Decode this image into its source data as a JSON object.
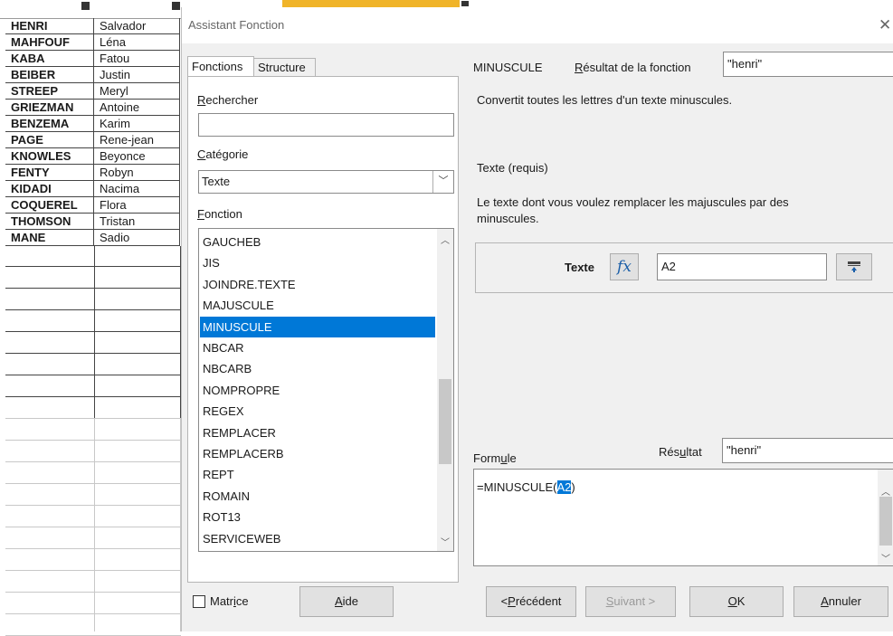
{
  "sheet": {
    "rows": [
      {
        "a": "HENRI",
        "b": "Salvador"
      },
      {
        "a": "MAHFOUF",
        "b": "Léna"
      },
      {
        "a": "KABA",
        "b": "Fatou"
      },
      {
        "a": "BEIBER",
        "b": "Justin"
      },
      {
        "a": "STREEP",
        "b": "Meryl"
      },
      {
        "a": "GRIEZMAN",
        "b": "Antoine"
      },
      {
        "a": "BENZEMA",
        "b": "Karim"
      },
      {
        "a": "PAGE",
        "b": "Rene-jean"
      },
      {
        "a": "KNOWLES",
        "b": "Beyonce"
      },
      {
        "a": "FENTY",
        "b": "Robyn"
      },
      {
        "a": "KIDADI",
        "b": "Nacima"
      },
      {
        "a": "COQUEREL",
        "b": "Flora"
      },
      {
        "a": "THOMSON",
        "b": "Tristan"
      },
      {
        "a": "MANE",
        "b": "Sadio"
      }
    ]
  },
  "dialog": {
    "title": "Assistant Fonction",
    "close_icon": "close-icon"
  },
  "tabs": {
    "functions": "Fonctions",
    "structure": "Structure"
  },
  "search": {
    "label_first": "R",
    "label_rest": "echercher",
    "value": ""
  },
  "category": {
    "label_first": "C",
    "label_rest": "atégorie",
    "value": "Texte"
  },
  "function_list": {
    "label_first": "F",
    "label_rest": "onction",
    "items": [
      "GAUCHEB",
      "JIS",
      "JOINDRE.TEXTE",
      "MAJUSCULE",
      "MINUSCULE",
      "NBCAR",
      "NBCARB",
      "NOMPROPRE",
      "REGEX",
      "REMPLACER",
      "REMPLACERB",
      "REPT",
      "ROMAIN",
      "ROT13",
      "SERVICEWEB"
    ],
    "selected": "MINUSCULE"
  },
  "info": {
    "function_name": "MINUSCULE",
    "result_label_first": "R",
    "result_label_rest": "ésultat de la fonction",
    "result_value": "\"henri\"",
    "description": "Convertit toutes les lettres d'un texte minuscules.",
    "param_title": "Texte (requis)",
    "param_desc_line1": "Le texte dont vous voulez remplacer les majuscules par des",
    "param_desc_line2": "minuscules."
  },
  "param": {
    "label": "Texte",
    "value": "A2",
    "fx_icon": "function-icon",
    "shrink_icon": "shrink-icon"
  },
  "formula": {
    "label_a": "Form",
    "label_u": "u",
    "label_b": "le",
    "result_label_a": "Rés",
    "result_label_u": "u",
    "result_label_b": "ltat",
    "result_value": "\"henri\"",
    "text_before": "=MINUSCULE(",
    "text_highlight": "A2",
    "text_after": ")"
  },
  "buttons": {
    "matrix_a": "Matr",
    "matrix_u": "i",
    "matrix_b": "ce",
    "help_u": "A",
    "help_rest": "ide",
    "prev_a": "<",
    "prev_u": "P",
    "prev_b": "récédent",
    "next_u": "S",
    "next_rest": "uivant >",
    "ok_u": "O",
    "ok_rest": "K",
    "cancel_u": "A",
    "cancel_rest": "nnuler"
  }
}
